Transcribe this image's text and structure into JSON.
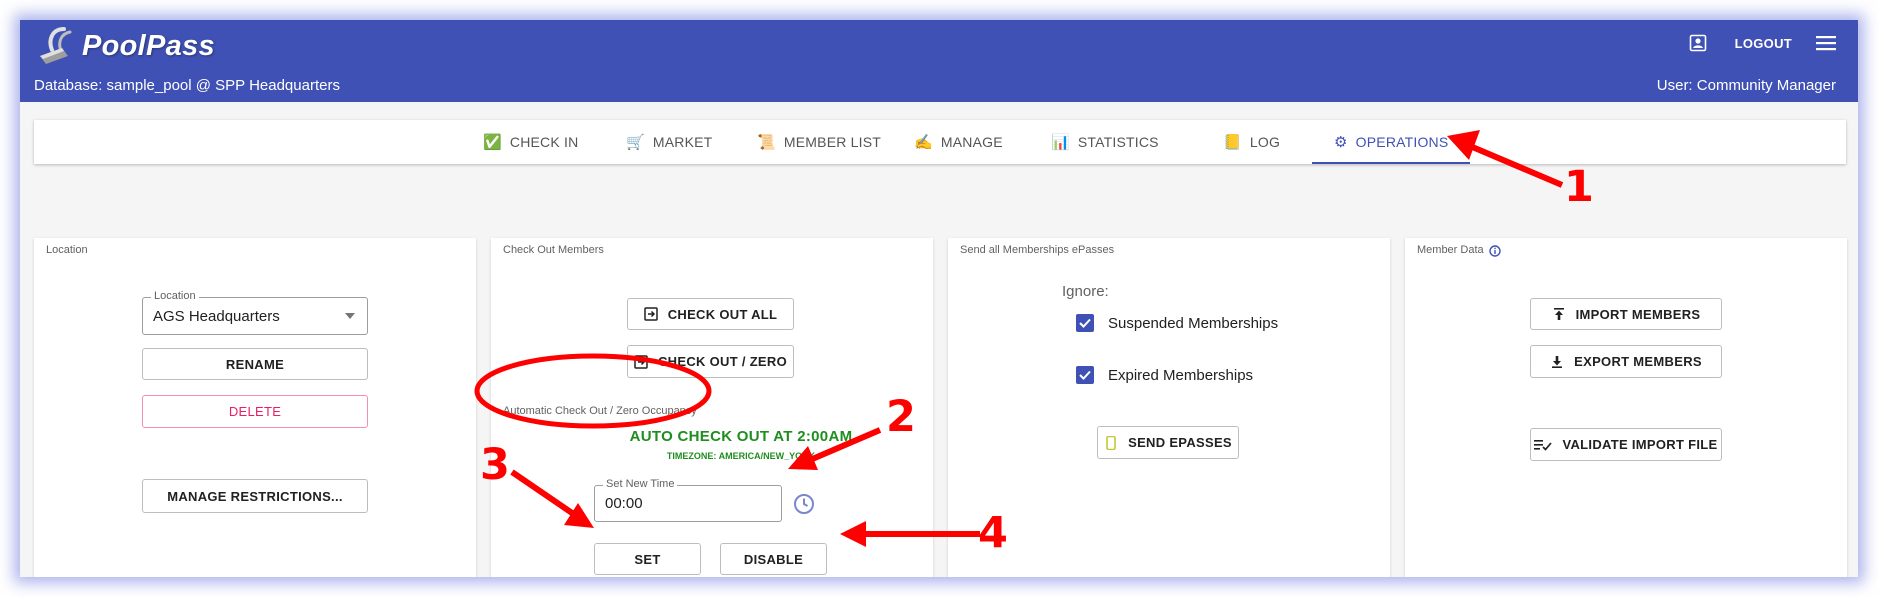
{
  "app": {
    "name": "PoolPass",
    "database_line": "Database: sample_pool @ SPP Headquarters",
    "user_line": "User: Community Manager",
    "logout_label": "LOGOUT"
  },
  "tabs": [
    {
      "label": "CHECK IN",
      "icon": "check-mark-icon",
      "glyph": "✅"
    },
    {
      "label": "MARKET",
      "icon": "cart-icon",
      "glyph": "🛒"
    },
    {
      "label": "MEMBER LIST",
      "icon": "scroll-icon",
      "glyph": "📜"
    },
    {
      "label": "MANAGE",
      "icon": "writing-hand-icon",
      "glyph": "✍"
    },
    {
      "label": "STATISTICS",
      "icon": "bar-chart-icon",
      "glyph": "📊"
    },
    {
      "label": "LOG",
      "icon": "ledger-icon",
      "glyph": "📒"
    },
    {
      "label": "OPERATIONS",
      "icon": "gear-icon",
      "glyph": "⚙",
      "active": true
    }
  ],
  "location_card": {
    "title": "Location",
    "select_label": "Location",
    "select_value": "AGS Headquarters",
    "rename_label": "RENAME",
    "delete_label": "DELETE",
    "restrictions_label": "MANAGE RESTRICTIONS..."
  },
  "checkout_card": {
    "title": "Check Out Members",
    "check_out_all_label": "CHECK OUT ALL",
    "check_out_zero_label": "CHECK OUT / ZERO",
    "auto_section_label": "Automatic Check Out / Zero Occupancy",
    "auto_status": "AUTO CHECK OUT AT 2:00AM",
    "timezone": "TIMEZONE: AMERICA/NEW_YORK",
    "time_field_label": "Set New Time",
    "time_field_value": "00:00",
    "set_label": "SET",
    "disable_label": "DISABLE"
  },
  "epass_card": {
    "title": "Send all Memberships ePasses",
    "ignore_label": "Ignore:",
    "suspended_label": "Suspended Memberships",
    "suspended_checked": true,
    "expired_label": "Expired Memberships",
    "expired_checked": true,
    "send_label": "SEND EPASSES"
  },
  "member_data_card": {
    "title": "Member Data",
    "import_label": "IMPORT MEMBERS",
    "export_label": "EXPORT MEMBERS",
    "validate_label": "VALIDATE IMPORT FILE"
  },
  "annotations": {
    "color": "#ff0000",
    "numbers": [
      "1",
      "2",
      "3",
      "4"
    ]
  },
  "colors": {
    "primary": "#3f51b5",
    "status_green": "#1e8e1e",
    "danger": "#e91e63"
  }
}
